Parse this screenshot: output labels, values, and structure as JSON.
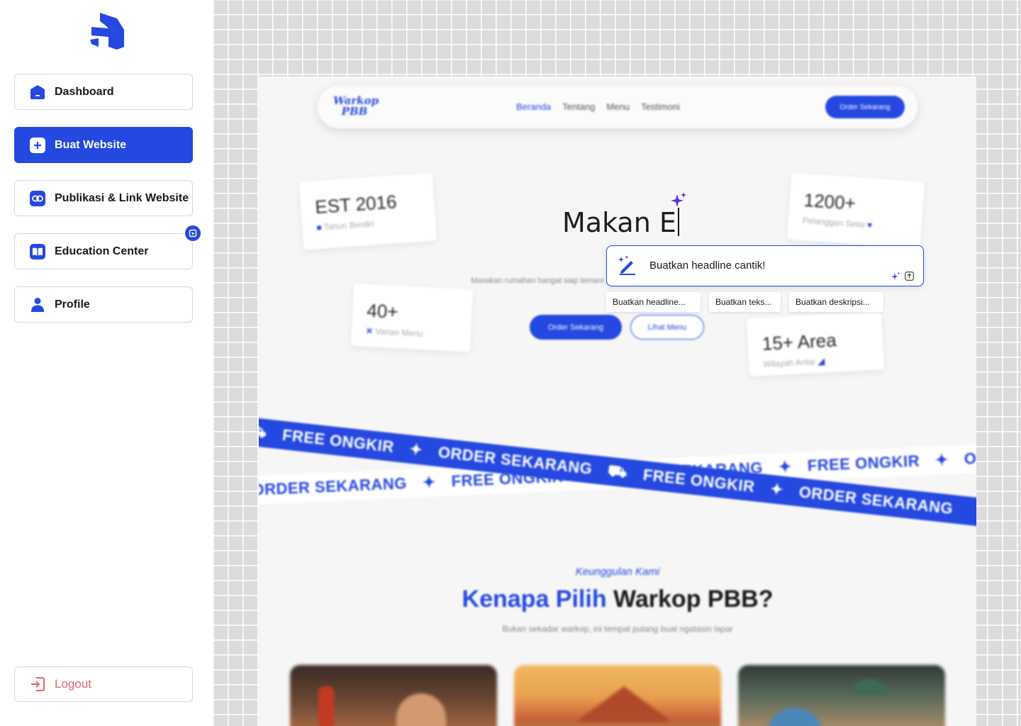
{
  "sidebar": {
    "items": [
      {
        "label": "Dashboard",
        "icon": "home-icon"
      },
      {
        "label": "Buat Website",
        "icon": "plus-square-icon"
      },
      {
        "label": "Publikasi & Link Website",
        "icon": "link-icon"
      },
      {
        "label": "Education Center",
        "icon": "book-icon"
      },
      {
        "label": "Profile",
        "icon": "user-icon"
      }
    ],
    "logout_label": "Logout"
  },
  "preview": {
    "logo_line1": "Warkop",
    "logo_line2": "PBB",
    "nav_links": [
      "Beranda",
      "Tentang",
      "Menu",
      "Testimoni"
    ],
    "nav_cta": "Order Sekarang",
    "stats": [
      {
        "value": "EST 2016",
        "label": "Tahun Berdiri"
      },
      {
        "value": "1200+",
        "label": "Pelanggan Setia"
      },
      {
        "value": "40+",
        "label": "Varian Menu"
      },
      {
        "value": "15+ Area",
        "label": "Wilayah Antar"
      }
    ],
    "headline": "Makan E",
    "hero_desc": "Masakan rumahan hangat siap temani ... lezat langsung ...",
    "hero_btn_primary": "Order Sekarang",
    "hero_btn_secondary": "Lihat Menu",
    "ribbon_free": "FREE ONGKIR",
    "ribbon_order": "ORDER SEKARANG",
    "section_eyebrow": "Keunggulan Kami",
    "section_title_hl": "Kenapa Pilih",
    "section_title_rest": "Warkop PBB?",
    "section_sub": "Bukan sekadar warkop, ini tempat pulang buat ngatasin lapar"
  },
  "ai_prompt": {
    "value": "Buatkan headline cantik!",
    "suggestions": [
      "Buatkan headline...",
      "Buatkan teks...",
      "Buatkan deskripsi..."
    ]
  },
  "colors": {
    "accent": "#2448e0",
    "danger": "#e0646c",
    "sparkle": "#5b2ee0"
  }
}
